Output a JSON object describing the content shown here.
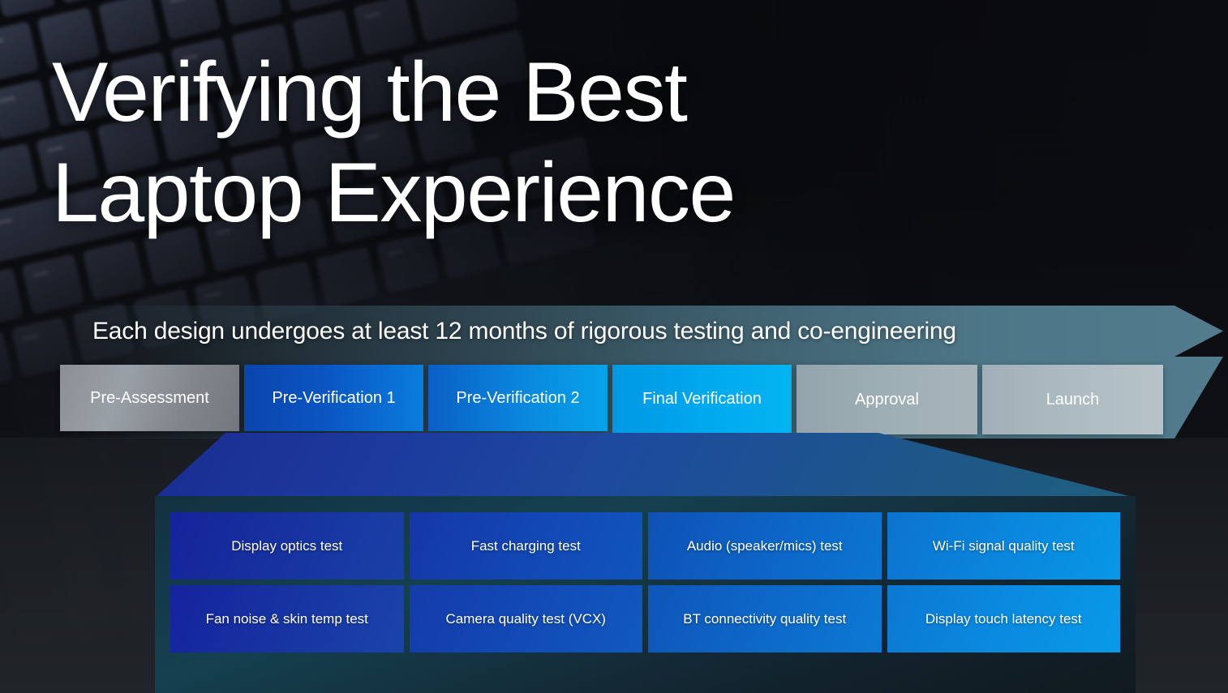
{
  "slide": {
    "title_lines": [
      "Verifying the Best",
      "Laptop Experience"
    ],
    "banner_text": "Each design undergoes at least 12 months of rigorous testing and co-engineering",
    "background_icon": "laptop-keyboard-photo"
  },
  "process": {
    "stages": [
      {
        "label": "Pre-Assessment",
        "color": "#8b8f95"
      },
      {
        "label": "Pre-Verification 1",
        "color": "#0a55c2"
      },
      {
        "label": "Pre-Verification 2",
        "color": "#0a86dd"
      },
      {
        "label": "Final Verification",
        "color": "#00a8ee"
      },
      {
        "label": "Approval",
        "color": "#9fafb6"
      },
      {
        "label": "Launch",
        "color": "#aebcc3"
      }
    ]
  },
  "tests": {
    "row1": [
      "Display optics test",
      "Fast charging test",
      "Audio (speaker/mics) test",
      "Wi-Fi signal quality test"
    ],
    "row2": [
      "Fan noise & skin temp test",
      "Camera quality test (VCX)",
      "BT connectivity quality test",
      "Display touch latency test"
    ]
  },
  "colors": {
    "banner_accent": "#527c8d",
    "funnel_start": "#1c2a86",
    "funnel_end": "#20617c",
    "panel_bg": "#133a4c",
    "title_text": "#ffffff"
  }
}
